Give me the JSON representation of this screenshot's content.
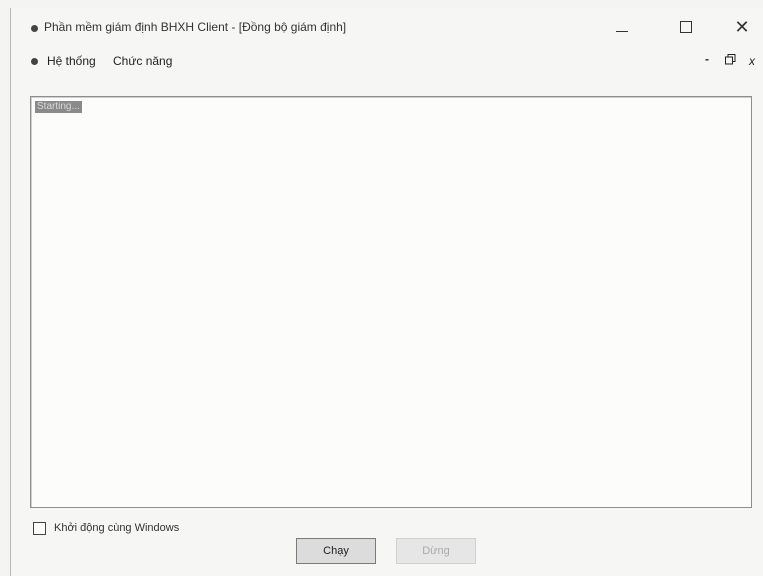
{
  "window": {
    "title": "Phần mềm giám định BHXH Client - [Đồng bộ giám định]",
    "controls": {
      "minimize": "—",
      "maximize": "□",
      "close": "✕"
    }
  },
  "menubar": {
    "items": [
      {
        "label": "Hệ thống"
      },
      {
        "label": "Chức năng"
      }
    ],
    "mdi_controls": {
      "minimize": "-",
      "restore": "🗗",
      "close": "x"
    }
  },
  "log": {
    "text": "Starting..."
  },
  "startup": {
    "label": "Khởi động cùng Windows",
    "checked": false
  },
  "buttons": {
    "run_label": "Chạy",
    "stop_label": "Dừng",
    "stop_enabled": false
  }
}
